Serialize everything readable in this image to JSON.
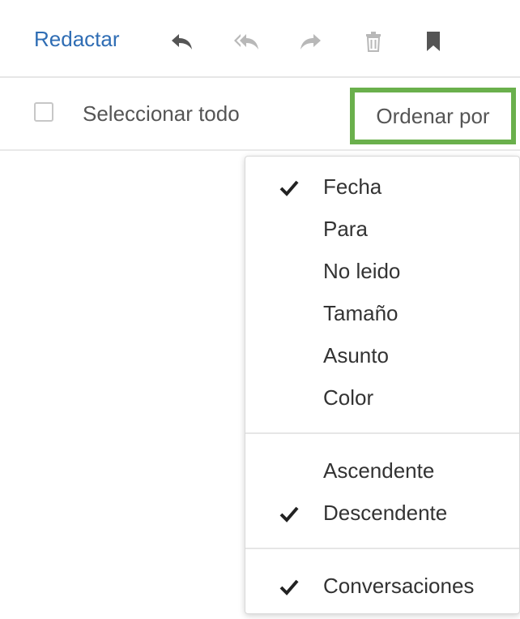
{
  "toolbar": {
    "compose_label": "Redactar",
    "icons": [
      "reply-icon",
      "reply-all-icon",
      "forward-icon",
      "trash-icon",
      "bookmark-icon"
    ]
  },
  "selection_bar": {
    "select_all_label": "Seleccionar todo",
    "sort_label": "Ordenar por",
    "highlight_color": "#6ab04c"
  },
  "sort_menu": {
    "fields": [
      {
        "label": "Fecha",
        "checked": true
      },
      {
        "label": "Para",
        "checked": false
      },
      {
        "label": "No leido",
        "checked": false
      },
      {
        "label": "Tamaño",
        "checked": false
      },
      {
        "label": "Asunto",
        "checked": false
      },
      {
        "label": "Color",
        "checked": false
      }
    ],
    "order": [
      {
        "label": "Ascendente",
        "checked": false
      },
      {
        "label": "Descendente",
        "checked": true
      }
    ],
    "conversations": {
      "label": "Conversaciones",
      "checked": true
    }
  },
  "colors": {
    "link": "#2f6db4",
    "icon": "#555555",
    "icon_faded": "#b8b8b8"
  }
}
